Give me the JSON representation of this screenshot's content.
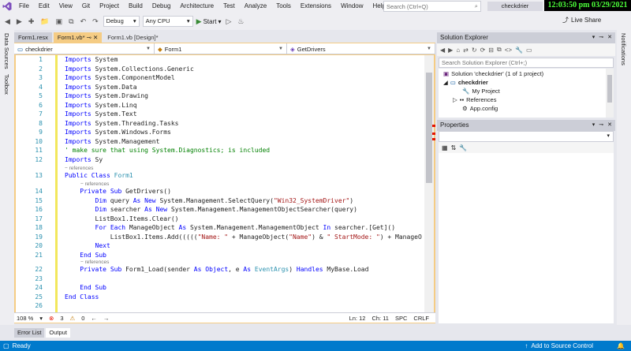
{
  "menu": {
    "items": [
      "File",
      "Edit",
      "View",
      "Git",
      "Project",
      "Build",
      "Debug",
      "Architecture",
      "Test",
      "Analyze",
      "Tools",
      "Extensions",
      "Window",
      "Help"
    ],
    "search_placeholder": "Search (Ctrl+Q)",
    "solution_name": "checkdrier"
  },
  "clock": "12:03:50 pm 03/29/2021",
  "toolbar": {
    "config": "Debug",
    "platform": "Any CPU",
    "start_label": "Start",
    "live_share": "Live Share"
  },
  "side_tabs": {
    "left": [
      "Data Sources",
      "Toolbox"
    ],
    "right": [
      "Notifications"
    ]
  },
  "doc_tabs": [
    {
      "label": "Form1.resx"
    },
    {
      "label": "Form1.vb*",
      "active": true
    },
    {
      "label": "Form1.vb [Design]*"
    }
  ],
  "navbar": {
    "project": "checkdrier",
    "class": "Form1",
    "member": "GetDrivers"
  },
  "editor": {
    "references_label": "references",
    "zoom": "108 %",
    "errors": "3",
    "warnings": "0",
    "line": "Ln: 12",
    "col": "Ch: 11",
    "spc": "SPC",
    "eol": "CRLF"
  },
  "code_lines": [
    {
      "n": "1",
      "text": "Imports System"
    },
    {
      "n": "2",
      "text": "Imports System.Collections.Generic"
    },
    {
      "n": "3",
      "text": "Imports System.ComponentModel"
    },
    {
      "n": "4",
      "text": "Imports System.Data"
    },
    {
      "n": "5",
      "text": "Imports System.Drawing"
    },
    {
      "n": "6",
      "text": "Imports System.Linq"
    },
    {
      "n": "7",
      "text": "Imports System.Text"
    },
    {
      "n": "8",
      "text": "Imports System.Threading.Tasks"
    },
    {
      "n": "9",
      "text": "Imports System.Windows.Forms"
    },
    {
      "n": "10",
      "text": "Imports System.Management"
    },
    {
      "n": "11",
      "text": "' make sure that using System.Diagnostics; is included"
    },
    {
      "n": "12",
      "text": "Imports Sy"
    },
    {
      "n": "13",
      "text": "Public Class Form1"
    },
    {
      "n": "14",
      "text": "    Private Sub GetDrivers()"
    },
    {
      "n": "15",
      "text": "        Dim query As New System.Management.SelectQuery(\"Win32_SystemDriver\")"
    },
    {
      "n": "16",
      "text": "        Dim searcher As New System.Management.ManagementObjectSearcher(query)"
    },
    {
      "n": "17",
      "text": "        ListBox1.Items.Clear()"
    },
    {
      "n": "18",
      "text": "        For Each ManageObject As System.Management.ManagementObject In searcher.[Get]()"
    },
    {
      "n": "19",
      "text": "            ListBox1.Items.Add(((((\"Name: \" + ManageObject(\"Name\") & \" StartMode: \") + ManageO"
    },
    {
      "n": "20",
      "text": "        Next"
    },
    {
      "n": "21",
      "text": "    End Sub"
    },
    {
      "n": "22",
      "text": "    Private Sub Form1_Load(sender As Object, e As EventArgs) Handles MyBase.Load"
    },
    {
      "n": "23",
      "text": ""
    },
    {
      "n": "24",
      "text": "    End Sub"
    },
    {
      "n": "25",
      "text": "End Class"
    },
    {
      "n": "26",
      "text": ""
    }
  ],
  "solution_explorer": {
    "title": "Solution Explorer",
    "search_placeholder": "Search Solution Explorer (Ctrl+;)",
    "items": [
      {
        "label": "Solution 'checkdrier' (1 of 1 project)"
      },
      {
        "label": "checkdrier"
      },
      {
        "label": "My Project"
      },
      {
        "label": "References"
      },
      {
        "label": "App.config"
      }
    ]
  },
  "properties": {
    "title": "Properties"
  },
  "bottom_tabs": [
    "Error List",
    "Output"
  ],
  "status": {
    "ready": "Ready",
    "add_source": "Add to Source Control"
  }
}
